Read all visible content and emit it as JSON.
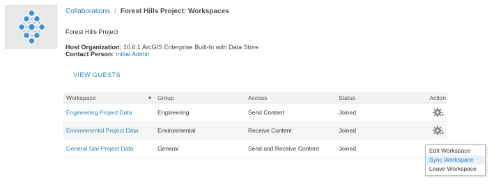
{
  "thumbnail": {
    "icon": "network-hexagon-icon",
    "colors": {
      "node": "#3d8fd6",
      "ring": "#ffffff",
      "bg": "#e8e8e8"
    }
  },
  "breadcrumb": {
    "root": "Collaborations",
    "separator": "/",
    "current": "Forest Hills Project: Workspaces"
  },
  "project": {
    "name": "Forest Hills Project",
    "host_label": "Host Organization:",
    "host_value": "10.6.1 ArcGIS Enterprise Built-In with Data Store",
    "contact_label": "Contact Person:",
    "contact_value": "Initial Admin"
  },
  "view_guests": "VIEW GUESTS",
  "table": {
    "headers": {
      "workspace": "Workspace",
      "group": "Group",
      "access": "Access",
      "status": "Status",
      "action": "Action"
    },
    "sort_indicator": "▲",
    "rows": [
      {
        "workspace": "Engineering Project Data",
        "group": "Engineering",
        "access": "Send Content",
        "status": "Joined"
      },
      {
        "workspace": "Environmental Project Data",
        "group": "Environmental",
        "access": "Receive Content",
        "status": "Joined"
      },
      {
        "workspace": "General Site Project Data",
        "group": "General",
        "access": "Send and Receive Content",
        "status": "Joined"
      }
    ]
  },
  "action_menu": {
    "items": [
      "Edit Workspace",
      "Sync Workspace",
      "Leave Workspace"
    ],
    "highlighted": "Sync Workspace"
  },
  "colors": {
    "link": "#2d7fb6",
    "header_bg": "#f2f2f2",
    "alt_row": "#f5f5f5"
  }
}
